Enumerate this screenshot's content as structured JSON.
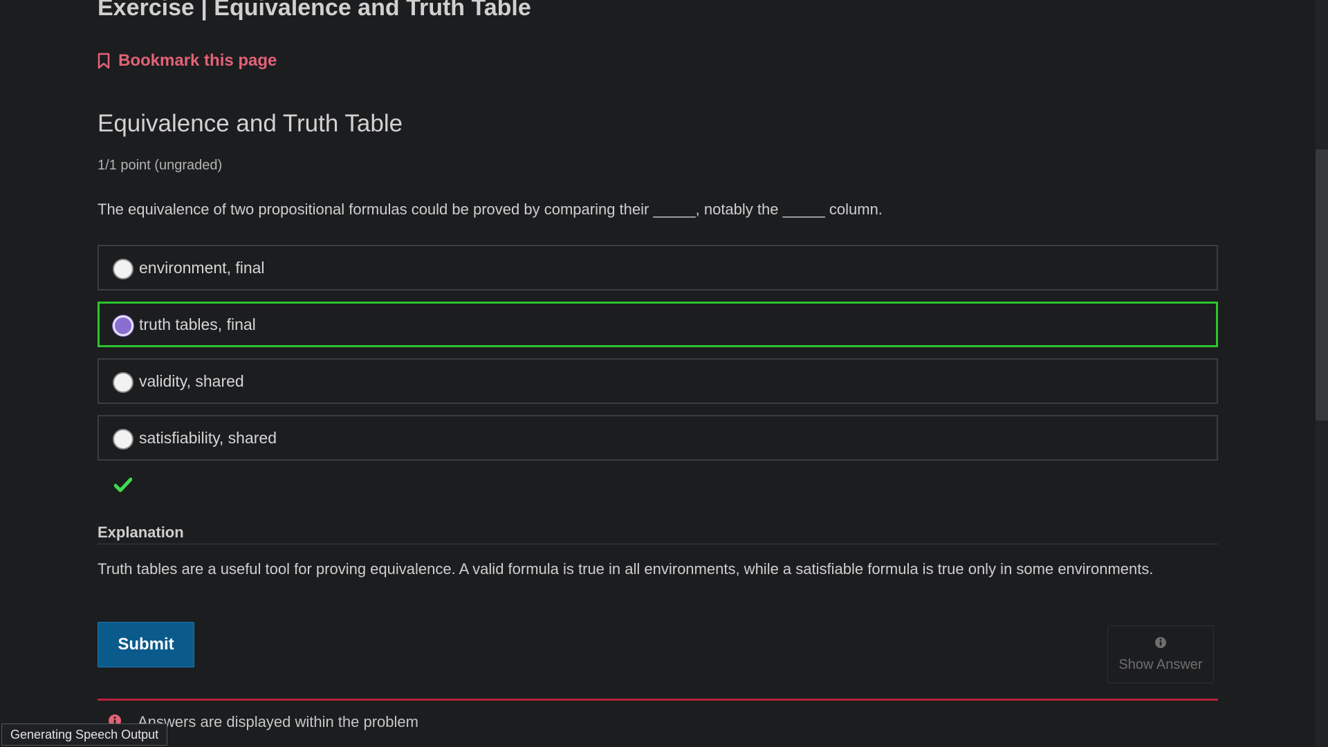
{
  "header": {
    "unit_title": "Exercise | Equivalence and Truth Table",
    "bookmark_label": "Bookmark this page"
  },
  "problem": {
    "title": "Equivalence and Truth Table",
    "points": "1/1 point (ungraded)",
    "question": "The equivalence of two propositional formulas could be proved by comparing their _____, notably the _____ column.",
    "options": [
      {
        "label": "environment, final",
        "selected": false
      },
      {
        "label": "truth tables, final",
        "selected": true
      },
      {
        "label": "validity, shared",
        "selected": false
      },
      {
        "label": "satisfiability, shared",
        "selected": false
      }
    ],
    "result": "correct"
  },
  "explanation": {
    "heading": "Explanation",
    "text": "Truth tables are a useful tool for proving equivalence. A valid formula is true in all environments, while a satisfiable formula is true only in some environments."
  },
  "actions": {
    "submit_label": "Submit",
    "show_answer_label": "Show Answer"
  },
  "notice": {
    "text": "Answers are displayed within the problem"
  },
  "status_tooltip": "Generating Speech Output",
  "colors": {
    "background": "#1c1d1f",
    "bookmark": "#e36277",
    "correct_border": "#2ec52e",
    "check": "#3ddc4f",
    "submit_bg": "#0a5a8c",
    "radio_selected": "#8a6fd1",
    "notice_rule": "#b8213a"
  },
  "icons": {
    "bookmark": "bookmark-icon",
    "check": "check-icon",
    "info": "info-icon",
    "notice": "error-icon"
  }
}
